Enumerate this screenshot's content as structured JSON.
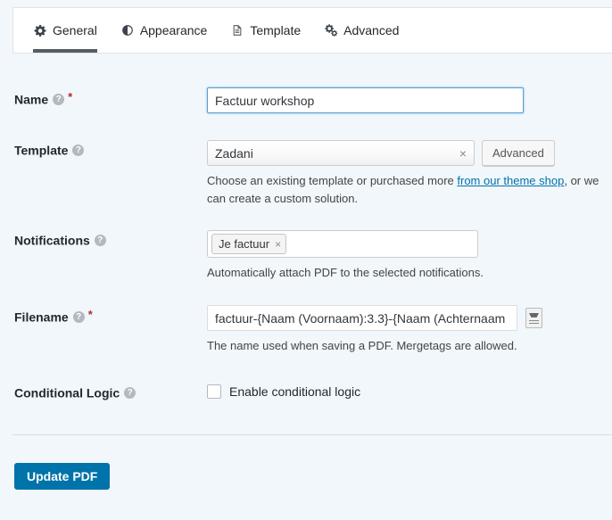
{
  "tabs": [
    {
      "label": "General",
      "icon": "gear-icon",
      "active": true
    },
    {
      "label": "Appearance",
      "icon": "contrast-icon",
      "active": false
    },
    {
      "label": "Template",
      "icon": "document-icon",
      "active": false
    },
    {
      "label": "Advanced",
      "icon": "gears-icon",
      "active": false
    }
  ],
  "fields": {
    "name": {
      "label": "Name",
      "required_marker": "*",
      "help_icon": "?",
      "value": "Factuur workshop"
    },
    "template": {
      "label": "Template",
      "help_icon": "?",
      "value": "Zadani",
      "clear_icon": "×",
      "advanced_button": "Advanced",
      "description_before_link": "Choose an existing template or purchased more ",
      "description_link": "from our theme shop",
      "description_after_link": ", or we can create a",
      "description_line2": "custom solution."
    },
    "notifications": {
      "label": "Notifications",
      "help_icon": "?",
      "tags": [
        {
          "label": "Je factuur",
          "remove_icon": "×"
        }
      ],
      "description": "Automatically attach PDF to the selected notifications."
    },
    "filename": {
      "label": "Filename",
      "required_marker": "*",
      "help_icon": "?",
      "value": "factuur-{Naam (Voornaam):3.3}-{Naam (Achternaam",
      "mergetag_icon": "mergetag-icon",
      "description": "The name used when saving a PDF. Mergetags are allowed."
    },
    "conditional_logic": {
      "label": "Conditional Logic",
      "help_icon": "?",
      "checkbox_label": "Enable conditional logic",
      "checked": false
    }
  },
  "submit": {
    "label": "Update PDF"
  },
  "colors": {
    "page_background": "#f1f7fb",
    "panel_background": "#ffffff",
    "primary_button": "#0073aa",
    "link": "#0073aa",
    "active_tab_underline": "#555d66",
    "required_asterisk": "#b32d2e",
    "focus_border": "#5b9dd9"
  }
}
